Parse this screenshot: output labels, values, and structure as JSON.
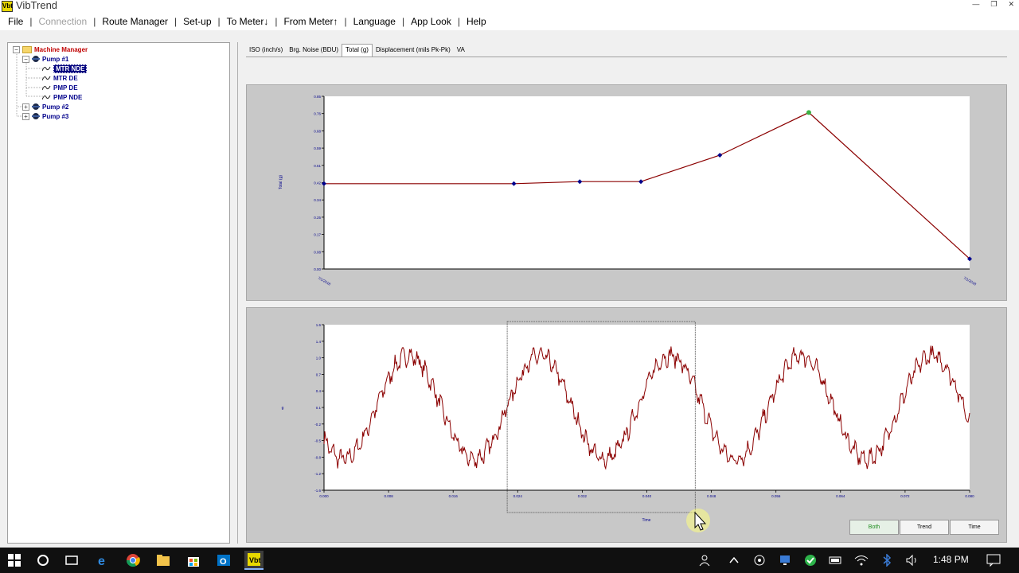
{
  "window": {
    "title": "VibTrend",
    "icon_text": "Vbt"
  },
  "menu": [
    {
      "label": "File",
      "enabled": true
    },
    {
      "label": "Connection",
      "enabled": false
    },
    {
      "label": "Route Manager",
      "enabled": true
    },
    {
      "label": "Set-up",
      "enabled": true
    },
    {
      "label": "To Meter↓",
      "enabled": true
    },
    {
      "label": "From Meter↑",
      "enabled": true
    },
    {
      "label": "Language",
      "enabled": true
    },
    {
      "label": "App Look",
      "enabled": true
    },
    {
      "label": "Help",
      "enabled": true
    }
  ],
  "tree": {
    "root": "Machine Manager",
    "pump1": "Pump #1",
    "sensors": [
      "MTR NDE",
      "MTR DE",
      "PMP DE",
      "PMP NDE"
    ],
    "selected_sensor": "MTR NDE",
    "pump2": "Pump #2",
    "pump3": "Pump #3"
  },
  "tabs": [
    {
      "label": "ISO (inch/s)",
      "active": false
    },
    {
      "label": "Brg. Noise (BDU)",
      "active": false
    },
    {
      "label": "Total (g)",
      "active": true
    },
    {
      "label": "Displacement (mils Pk-Pk)",
      "active": false
    },
    {
      "label": "VA",
      "active": false
    }
  ],
  "buttons": {
    "both": "Both",
    "trend": "Trend",
    "time": "Time"
  },
  "taskbar": {
    "time": "1:48 PM"
  },
  "colors": {
    "trend_line": "#8b0000",
    "marker": "#00008b",
    "highlight_marker": "#3cb043",
    "selection": "#00007f",
    "wave": "#8b0000"
  },
  "chart_data": [
    {
      "type": "line",
      "ylabel": "Total (g)",
      "yticks": [
        "0.00",
        "0.08",
        "0.17",
        "0.25",
        "0.34",
        "0.42",
        "0.51",
        "0.59",
        "0.68",
        "0.76",
        "0.85"
      ],
      "ylim": [
        0,
        0.85
      ],
      "xtick_labels": [
        "7/1/2018",
        "7/1/2018"
      ],
      "x": [
        0,
        0.2941,
        0.3961,
        0.4908,
        0.6131,
        0.7509,
        1.0
      ],
      "values": [
        0.42,
        0.42,
        0.43,
        0.43,
        0.56,
        0.77,
        0.05
      ],
      "highlight_index": 5
    },
    {
      "type": "line",
      "xlabel": "Time",
      "ylabel": "g",
      "xticks": [
        "0.000",
        "0.008",
        "0.016",
        "0.024",
        "0.032",
        "0.040",
        "0.048",
        "0.056",
        "0.064",
        "0.072",
        "0.080"
      ],
      "xlim": [
        0,
        0.08
      ],
      "yticks": [
        "-1.6",
        "-1.2",
        "-0.8",
        "-0.5",
        "-0.2",
        "0.1",
        "0.4",
        "0.7",
        "1.0",
        "1.4",
        "1.6"
      ],
      "ylim": [
        -1.6,
        1.6
      ],
      "signal": {
        "amplitude": 1.0,
        "period": 0.0162,
        "peak_at": 0.0105,
        "noise": 0.2
      },
      "selection": {
        "x_start": 0.0227,
        "x_end": 0.046
      }
    }
  ]
}
